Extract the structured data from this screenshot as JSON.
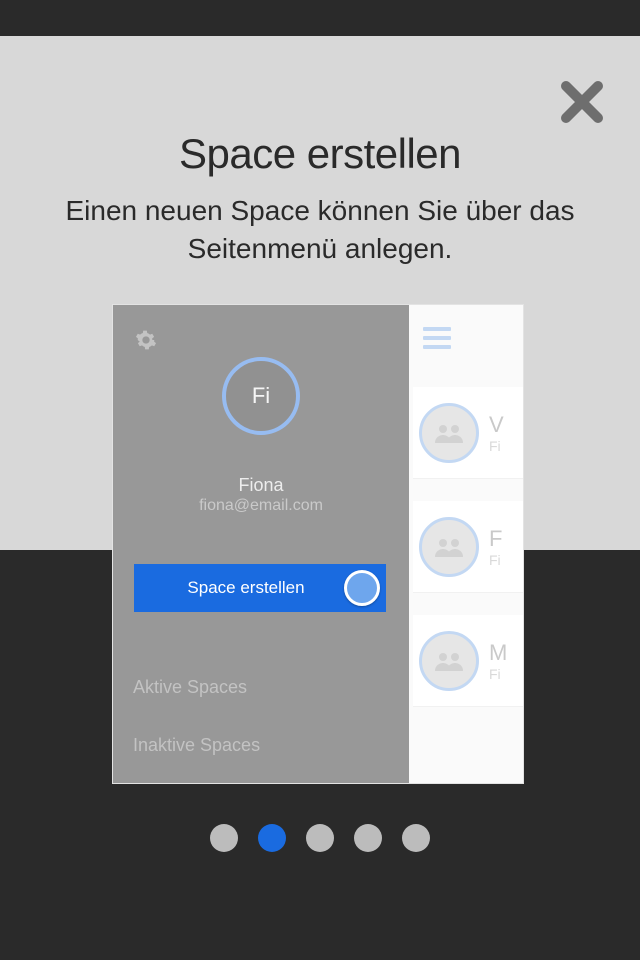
{
  "title": "Space erstellen",
  "subtitle": "Einen neuen Space können Sie über das Seitenmenü anlegen.",
  "user": {
    "initials": "Fi",
    "name": "Fiona",
    "email": "fiona@email.com"
  },
  "create_button_label": "Space erstellen",
  "sections": {
    "active_label": "Aktive Spaces",
    "inactive_label": "Inaktive Spaces"
  },
  "space_items": [
    {
      "title": "V",
      "sub": "Fi"
    },
    {
      "title": "F",
      "sub": "Fi"
    },
    {
      "title": "M",
      "sub": "Fi"
    }
  ],
  "page_dots": {
    "count": 5,
    "active_index": 1
  }
}
